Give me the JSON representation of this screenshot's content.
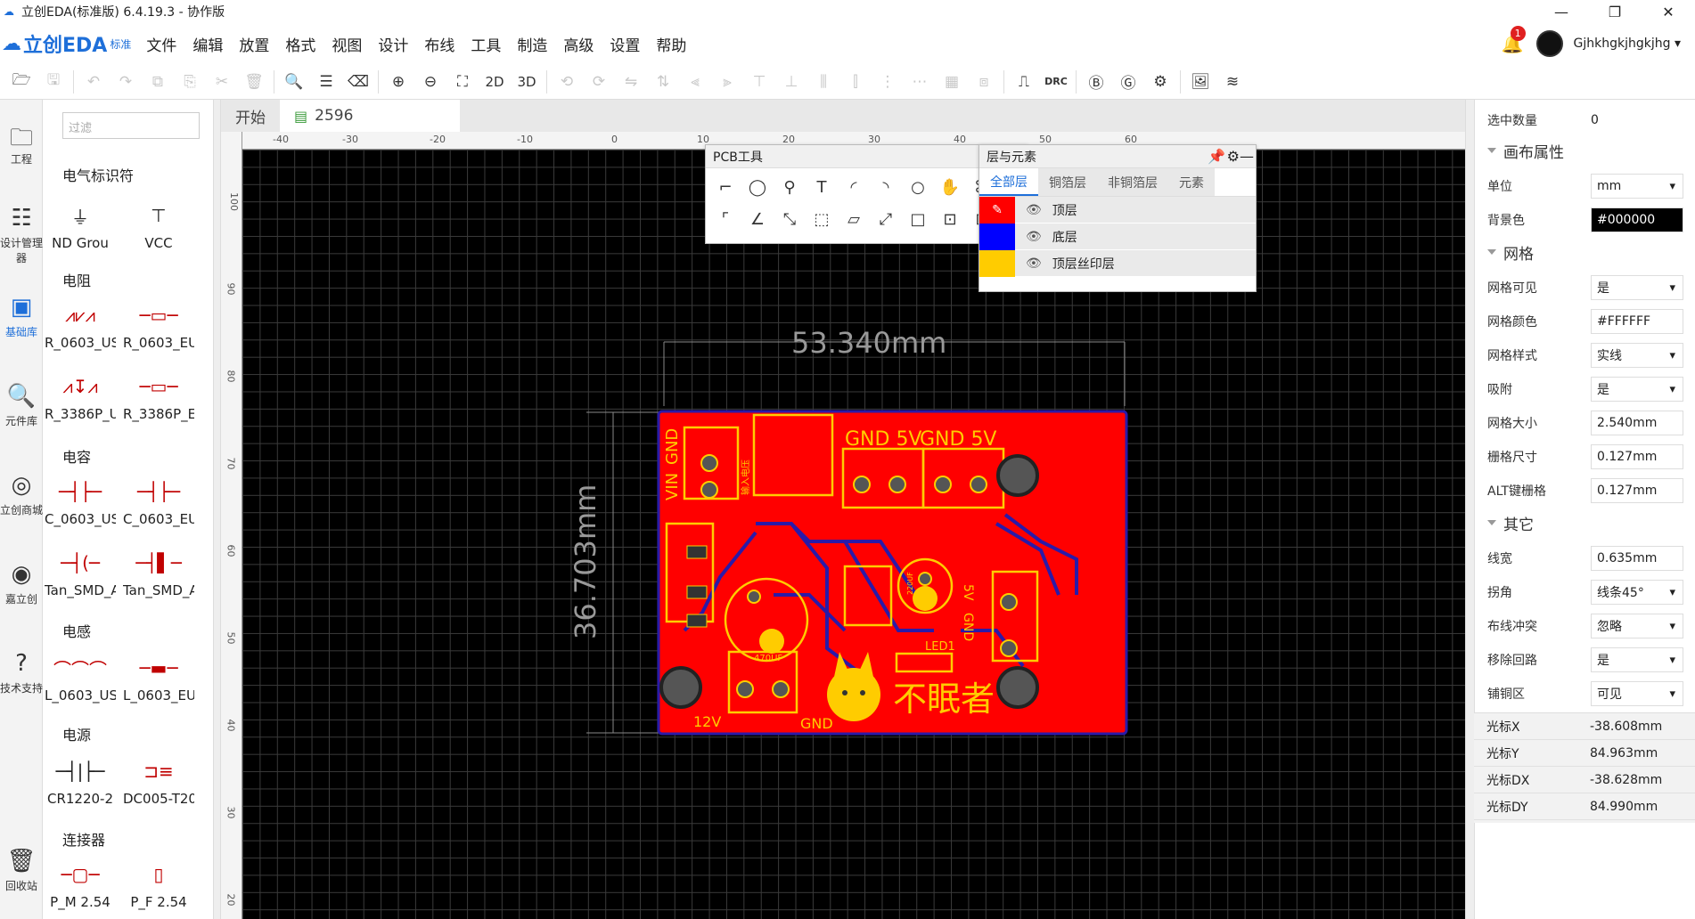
{
  "window": {
    "title": "立创EDA(标准版) 6.4.19.3 - 协作版",
    "min": "—",
    "max": "❐",
    "close": "✕"
  },
  "logo": {
    "text": "立创EDA",
    "edition": "标准"
  },
  "menus": [
    "文件",
    "编辑",
    "放置",
    "格式",
    "视图",
    "设计",
    "布线",
    "工具",
    "制造",
    "高级",
    "设置",
    "帮助"
  ],
  "user": {
    "notifications": "1",
    "name": "Gjhkhgkjhgkjhg",
    "caret": "▾"
  },
  "toolbar": {
    "view2d": "2D",
    "view3d": "3D",
    "drc": "DRC"
  },
  "leftnav": [
    {
      "label": "工程",
      "icon": "folder-icon"
    },
    {
      "label": "设计管理器",
      "icon": "design-manager-icon"
    },
    {
      "label": "基础库",
      "icon": "basic-library-icon"
    },
    {
      "label": "元件库",
      "icon": "component-library-icon"
    },
    {
      "label": "立创商城",
      "icon": "lcsc-icon"
    },
    {
      "label": "嘉立创",
      "icon": "jlc-icon"
    },
    {
      "label": "技术支持",
      "icon": "help-icon"
    },
    {
      "label": "回收站",
      "icon": "trash-icon"
    }
  ],
  "library": {
    "filter_placeholder": "过滤",
    "categories": [
      "电气标识符",
      "电阻",
      "电容",
      "电感",
      "电源",
      "连接器"
    ],
    "items": [
      [
        "ND Grou",
        "VCC"
      ],
      [
        "R_0603_US",
        "R_0603_EU"
      ],
      [
        "R_3386P_US",
        "R_3386P_EU"
      ],
      [
        "C_0603_US",
        "C_0603_EU"
      ],
      [
        "Tan_SMD_A",
        "Tan_SMD_A"
      ],
      [
        "L_0603_US",
        "L_0603_EU"
      ],
      [
        "CR1220-2",
        "DC005-T20"
      ],
      [
        "P_M 2.54",
        "P_F 2.54"
      ]
    ]
  },
  "tabs": {
    "start": "开始",
    "doc": "2596"
  },
  "rulers": {
    "top": [
      "-40",
      "-30",
      "-20",
      "-10",
      "0",
      "10",
      "20",
      "30",
      "40",
      "50",
      "60"
    ],
    "left": [
      "100",
      "90",
      "80",
      "70",
      "60",
      "50",
      "40",
      "30",
      "20"
    ]
  },
  "pcb": {
    "dim_h": "53.340mm",
    "dim_v": "36.703mm",
    "silk": {
      "gnd5v_1": "GND 5V",
      "gnd5v_2": "GND 5V",
      "vin": "VIN",
      "gnd_left": "GND",
      "input_v": "输入电压",
      "cap": "470UF",
      "cap2": "220UF",
      "v5": "5V",
      "gnd_right": "GND",
      "led": "LED1",
      "v12": "12V",
      "gnd_bottom": "GND",
      "brand": "不眠者"
    }
  },
  "pcbtools": {
    "title": "PCB工具",
    "min": "—"
  },
  "layers": {
    "title": "层与元素",
    "tabs": [
      "全部层",
      "铜箔层",
      "非铜箔层",
      "元素"
    ],
    "rows": [
      {
        "name": "顶层",
        "color": "#ff0000"
      },
      {
        "name": "底层",
        "color": "#0000ff"
      },
      {
        "name": "顶层丝印层",
        "color": "#ffcc00"
      }
    ]
  },
  "props": {
    "selected_label": "选中数量",
    "selected_value": "0",
    "canvas_section": "画布属性",
    "unit_label": "单位",
    "unit_value": "mm",
    "bg_label": "背景色",
    "bg_value": "#000000",
    "grid_section": "网格",
    "grid_visible_label": "网格可见",
    "grid_visible_value": "是",
    "grid_color_label": "网格颜色",
    "grid_color_value": "#FFFFFF",
    "grid_style_label": "网格样式",
    "grid_style_value": "实线",
    "snap_label": "吸附",
    "snap_value": "是",
    "grid_size_label": "网格大小",
    "grid_size_value": "2.540mm",
    "grid_snap_label": "栅格尺寸",
    "grid_snap_value": "0.127mm",
    "alt_label": "ALT键栅格",
    "alt_value": "0.127mm",
    "other_section": "其它",
    "width_label": "线宽",
    "width_value": "0.635mm",
    "corner_label": "拐角",
    "corner_value": "线条45°",
    "conflict_label": "布线冲突",
    "conflict_value": "忽略",
    "loop_label": "移除回路",
    "loop_value": "是",
    "pour_label": "铺铜区",
    "pour_value": "可见"
  },
  "cursor": {
    "x_label": "光标X",
    "x_value": "-38.608mm",
    "y_label": "光标Y",
    "y_value": "84.963mm",
    "dx_label": "光标DX",
    "dx_value": "-38.628mm",
    "dy_label": "光标DY",
    "dy_value": "84.990mm"
  }
}
